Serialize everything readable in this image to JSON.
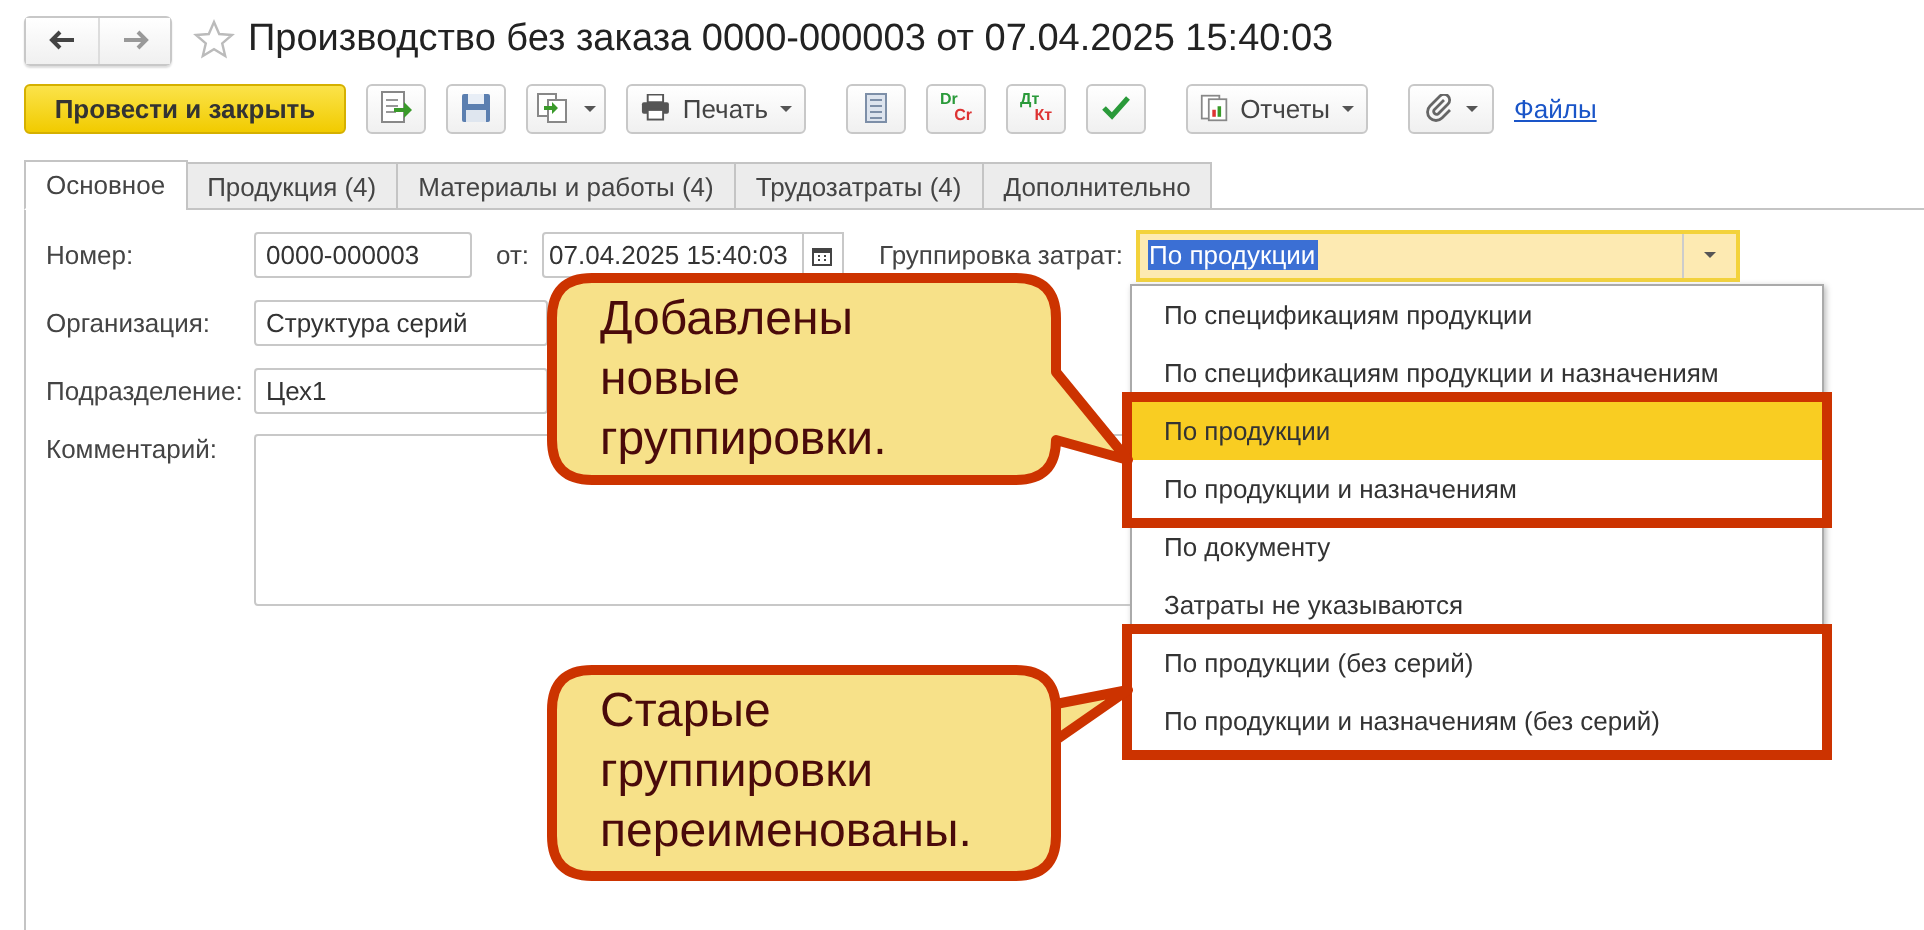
{
  "window": {
    "title": "Производство без заказа 0000-000003 от 07.04.2025 15:40:03",
    "favorite": false
  },
  "toolbar": {
    "primary": "Провести и закрыть",
    "print": "Печать",
    "dr": "Dr",
    "cr": "Cr",
    "dt": "Дт",
    "kt": "Кт",
    "reports": "Отчеты",
    "files": "Файлы"
  },
  "tabs": [
    {
      "label": "Основное",
      "selected": true
    },
    {
      "label": "Продукция (4)",
      "selected": false
    },
    {
      "label": "Материалы и работы (4)",
      "selected": false
    },
    {
      "label": "Трудозатраты (4)",
      "selected": false
    },
    {
      "label": "Дополнительно",
      "selected": false
    }
  ],
  "form": {
    "number_label": "Номер:",
    "number": "0000-000003",
    "date_label": "от:",
    "date": "07.04.2025 15:40:03",
    "grouping_label": "Группировка затрат:",
    "grouping": "По продукции",
    "organization_label": "Организация:",
    "organization": "Структура серий",
    "department_label": "Подразделение:",
    "department": "Цех1",
    "comment_label": "Комментарий:"
  },
  "dropdown": {
    "groups": [
      {
        "framed": false,
        "items": [
          {
            "label": "По спецификациям продукции",
            "selected": false
          },
          {
            "label": "По спецификациям продукции и назначениям",
            "selected": false
          }
        ]
      },
      {
        "framed": true,
        "items": [
          {
            "label": "По продукции",
            "selected": true
          },
          {
            "label": "По продукции и назначениям",
            "selected": false
          }
        ]
      },
      {
        "framed": false,
        "items": [
          {
            "label": "По документу",
            "selected": false
          },
          {
            "label": "Затраты не указываются",
            "selected": false
          }
        ]
      },
      {
        "framed": true,
        "items": [
          {
            "label": "По продукции (без серий)",
            "selected": false
          },
          {
            "label": "По продукции и назначениям (без серий)",
            "selected": false
          }
        ]
      }
    ]
  },
  "callouts": [
    {
      "text": "Добавлены новые группировки."
    },
    {
      "text": "Старые группировки переименованы."
    }
  ]
}
